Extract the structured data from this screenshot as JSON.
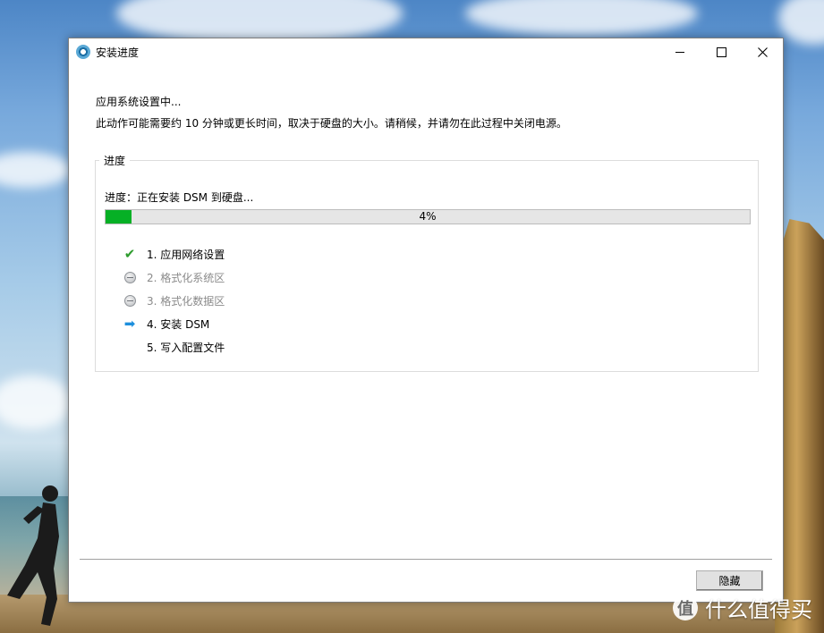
{
  "window": {
    "title": "安装进度",
    "icon": "synology-assistant-icon"
  },
  "content": {
    "heading": "应用系统设置中...",
    "description": "此动作可能需要约 10 分钟或更长时间，取决于硬盘的大小。请稍候，并请勿在此过程中关闭电源。"
  },
  "progress_group": {
    "label": "进度",
    "status": "进度：正在安装 DSM 到硬盘...",
    "percent": 4,
    "percent_label": "4%",
    "fill_color": "#06b025"
  },
  "steps": [
    {
      "label": "1. 应用网络设置",
      "state": "done",
      "icon": "check-icon"
    },
    {
      "label": "2. 格式化系统区",
      "state": "skipped",
      "icon": "minus-circle-icon"
    },
    {
      "label": "3. 格式化数据区",
      "state": "skipped",
      "icon": "minus-circle-icon"
    },
    {
      "label": "4. 安装 DSM",
      "state": "current",
      "icon": "arrow-right-icon"
    },
    {
      "label": "5. 写入配置文件",
      "state": "pending",
      "icon": ""
    }
  ],
  "footer": {
    "hide_button_label": "隐藏"
  },
  "watermark": {
    "logo": "值",
    "text": "什么值得买"
  }
}
